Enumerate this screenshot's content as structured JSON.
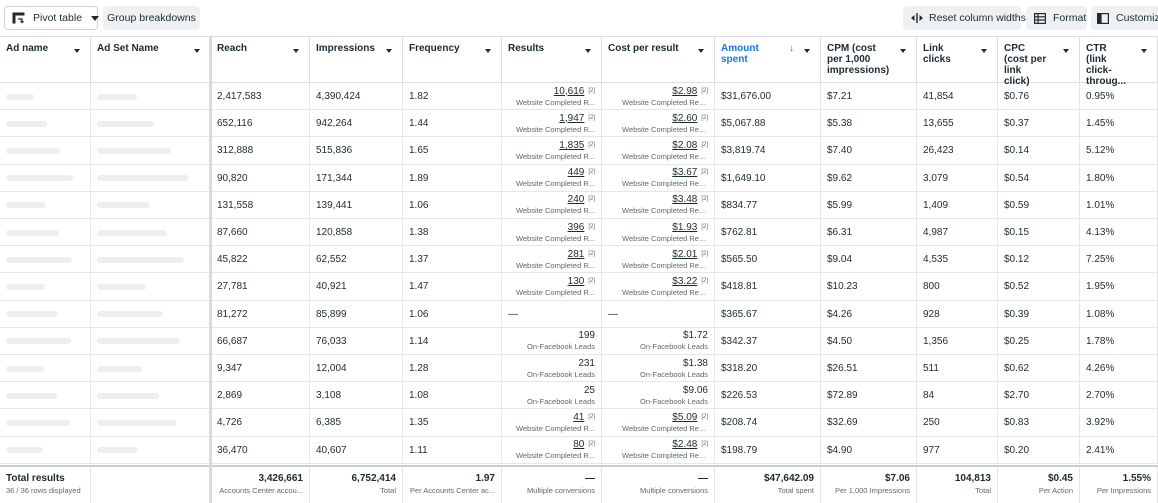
{
  "toolbar": {
    "pivot": "Pivot table",
    "group": "Group breakdowns",
    "reset": "Reset column widths",
    "format": "Format",
    "customize": "Customize"
  },
  "columns": [
    {
      "key": "ad_name",
      "label": "Ad name"
    },
    {
      "key": "adset",
      "label": "Ad Set Name"
    },
    {
      "key": "reach",
      "label": "Reach"
    },
    {
      "key": "impressions",
      "label": "Impressions"
    },
    {
      "key": "frequency",
      "label": "Frequency"
    },
    {
      "key": "results",
      "label": "Results"
    },
    {
      "key": "cpr",
      "label": "Cost per result"
    },
    {
      "key": "amount",
      "label": "Amount spent"
    },
    {
      "key": "cpm",
      "label": "CPM (cost per 1,000 impressions)"
    },
    {
      "key": "clicks",
      "label": "Link clicks"
    },
    {
      "key": "cpc",
      "label": "CPC (cost per link click)"
    },
    {
      "key": "ctr",
      "label": "CTR (link click-throug..."
    }
  ],
  "rows": [
    {
      "reach": "2,417,583",
      "impressions": "4,390,424",
      "frequency": "1.82",
      "results": "10,616",
      "results_sub": "Website Completed R...",
      "cpr": "$2.98",
      "cpr_sub": "Website Completed Regist...",
      "amount": "$31,676.00",
      "cpm": "$7.21",
      "clicks": "41,854",
      "cpc": "$0.76",
      "ctr": "0.95%",
      "link": true
    },
    {
      "reach": "652,116",
      "impressions": "942,264",
      "frequency": "1.44",
      "results": "1,947",
      "results_sub": "Website Completed R...",
      "cpr": "$2.60",
      "cpr_sub": "Website Completed Regist...",
      "amount": "$5,067.88",
      "cpm": "$5.38",
      "clicks": "13,655",
      "cpc": "$0.37",
      "ctr": "1.45%",
      "link": true
    },
    {
      "reach": "312,888",
      "impressions": "515,836",
      "frequency": "1.65",
      "results": "1,835",
      "results_sub": "Website Completed R...",
      "cpr": "$2.08",
      "cpr_sub": "Website Completed Regist...",
      "amount": "$3,819.74",
      "cpm": "$7.40",
      "clicks": "26,423",
      "cpc": "$0.14",
      "ctr": "5.12%",
      "link": true
    },
    {
      "reach": "90,820",
      "impressions": "171,344",
      "frequency": "1.89",
      "results": "449",
      "results_sub": "Website Completed R...",
      "cpr": "$3.67",
      "cpr_sub": "Website Completed Regist...",
      "amount": "$1,649.10",
      "cpm": "$9.62",
      "clicks": "3,079",
      "cpc": "$0.54",
      "ctr": "1.80%",
      "link": true
    },
    {
      "reach": "131,558",
      "impressions": "139,441",
      "frequency": "1.06",
      "results": "240",
      "results_sub": "Website Completed R...",
      "cpr": "$3.48",
      "cpr_sub": "Website Completed Regist...",
      "amount": "$834.77",
      "cpm": "$5.99",
      "clicks": "1,409",
      "cpc": "$0.59",
      "ctr": "1.01%",
      "link": true
    },
    {
      "reach": "87,660",
      "impressions": "120,858",
      "frequency": "1.38",
      "results": "396",
      "results_sub": "Website Completed R...",
      "cpr": "$1.93",
      "cpr_sub": "Website Completed Regist...",
      "amount": "$762.81",
      "cpm": "$6.31",
      "clicks": "4,987",
      "cpc": "$0.15",
      "ctr": "4.13%",
      "link": true
    },
    {
      "reach": "45,822",
      "impressions": "62,552",
      "frequency": "1.37",
      "results": "281",
      "results_sub": "Website Completed R...",
      "cpr": "$2.01",
      "cpr_sub": "Website Completed Regist...",
      "amount": "$565.50",
      "cpm": "$9.04",
      "clicks": "4,535",
      "cpc": "$0.12",
      "ctr": "7.25%",
      "link": true
    },
    {
      "reach": "27,781",
      "impressions": "40,921",
      "frequency": "1.47",
      "results": "130",
      "results_sub": "Website Completed R...",
      "cpr": "$3.22",
      "cpr_sub": "Website Completed Regist...",
      "amount": "$418.81",
      "cpm": "$10.23",
      "clicks": "800",
      "cpc": "$0.52",
      "ctr": "1.95%",
      "link": true
    },
    {
      "reach": "81,272",
      "impressions": "85,899",
      "frequency": "1.06",
      "results": "—",
      "results_sub": "",
      "cpr": "—",
      "cpr_sub": "",
      "amount": "$365.67",
      "cpm": "$4.26",
      "clicks": "928",
      "cpc": "$0.39",
      "ctr": "1.08%",
      "link": false,
      "dash": true
    },
    {
      "reach": "66,687",
      "impressions": "76,033",
      "frequency": "1.14",
      "results": "199",
      "results_sub": "On-Facebook Leads",
      "cpr": "$1.72",
      "cpr_sub": "On-Facebook Leads",
      "amount": "$342.37",
      "cpm": "$4.50",
      "clicks": "1,356",
      "cpc": "$0.25",
      "ctr": "1.78%",
      "link": false
    },
    {
      "reach": "9,347",
      "impressions": "12,004",
      "frequency": "1.28",
      "results": "231",
      "results_sub": "On-Facebook Leads",
      "cpr": "$1.38",
      "cpr_sub": "On-Facebook Leads",
      "amount": "$318.20",
      "cpm": "$26.51",
      "clicks": "511",
      "cpc": "$0.62",
      "ctr": "4.26%",
      "link": false
    },
    {
      "reach": "2,869",
      "impressions": "3,108",
      "frequency": "1.08",
      "results": "25",
      "results_sub": "On-Facebook Leads",
      "cpr": "$9.06",
      "cpr_sub": "On-Facebook Leads",
      "amount": "$226.53",
      "cpm": "$72.89",
      "clicks": "84",
      "cpc": "$2.70",
      "ctr": "2.70%",
      "link": false
    },
    {
      "reach": "4,726",
      "impressions": "6,385",
      "frequency": "1.35",
      "results": "41",
      "results_sub": "Website Completed R...",
      "cpr": "$5.09",
      "cpr_sub": "Website Completed Regist...",
      "amount": "$208.74",
      "cpm": "$32.69",
      "clicks": "250",
      "cpc": "$0.83",
      "ctr": "3.92%",
      "link": true
    },
    {
      "reach": "36,470",
      "impressions": "40,607",
      "frequency": "1.11",
      "results": "80",
      "results_sub": "Website Completed R...",
      "cpr": "$2.48",
      "cpr_sub": "Website Completed Regist...",
      "amount": "$198.79",
      "cpm": "$4.90",
      "clicks": "977",
      "cpc": "$0.20",
      "ctr": "2.41%",
      "link": true
    }
  ],
  "totals": {
    "label": "Total results",
    "rows_shown": "36 / 36 rows displayed",
    "reach": "3,426,661",
    "reach_sub": "Accounts Center accou...",
    "impressions": "6,752,414",
    "impressions_sub": "Total",
    "frequency": "1.97",
    "frequency_sub": "Per Accounts Center ac...",
    "results": "—",
    "results_sub": "Multiple conversions",
    "cpr": "—",
    "cpr_sub": "Multiple conversions",
    "amount": "$47,642.09",
    "amount_sub": "Total spent",
    "cpm": "$7.06",
    "cpm_sub": "Per 1,000 Impressions",
    "clicks": "104,813",
    "clicks_sub": "Total",
    "cpc": "$0.45",
    "cpc_sub": "Per Action",
    "ctr": "1.55%",
    "ctr_sub": "Per Impressions"
  },
  "sup_marker": "[2]",
  "colors": {
    "accent": "#1877f2",
    "border": "#dadde1",
    "muted": "#606770"
  }
}
